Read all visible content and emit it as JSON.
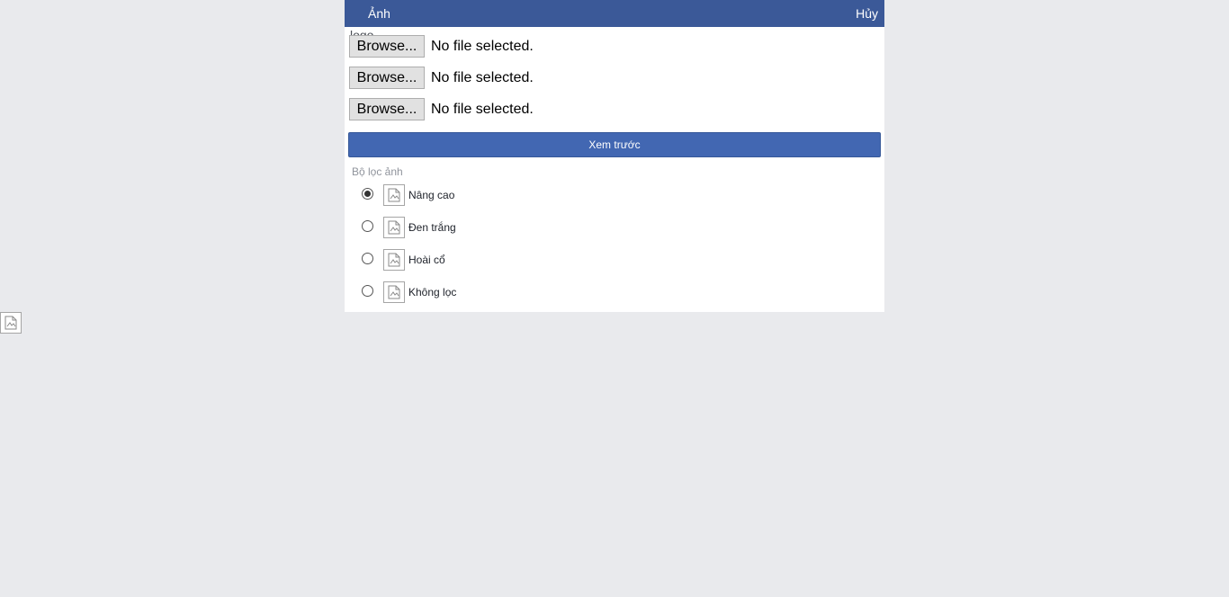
{
  "header": {
    "title": "Ảnh",
    "cancel_label": "Hủy"
  },
  "logo_label": "logo",
  "file_inputs": [
    {
      "button_label": "Browse...",
      "status": "No file selected."
    },
    {
      "button_label": "Browse...",
      "status": "No file selected."
    },
    {
      "button_label": "Browse...",
      "status": "No file selected."
    }
  ],
  "preview_button_label": "Xem trước",
  "filters": {
    "label": "Bộ lọc ảnh",
    "selected": "Nâng cao",
    "options": [
      {
        "name": "Nâng cao",
        "icon": "broken-image-icon",
        "checked": true
      },
      {
        "name": "Đen trắng",
        "icon": "broken-image-icon",
        "checked": false
      },
      {
        "name": "Hoài cổ",
        "icon": "broken-image-icon",
        "checked": false
      },
      {
        "name": "Không lọc",
        "icon": "broken-image-icon",
        "checked": false
      }
    ]
  },
  "colors": {
    "header_bg": "#3b5998",
    "button_bg": "#4267b2",
    "page_bg": "#e9eaed"
  }
}
